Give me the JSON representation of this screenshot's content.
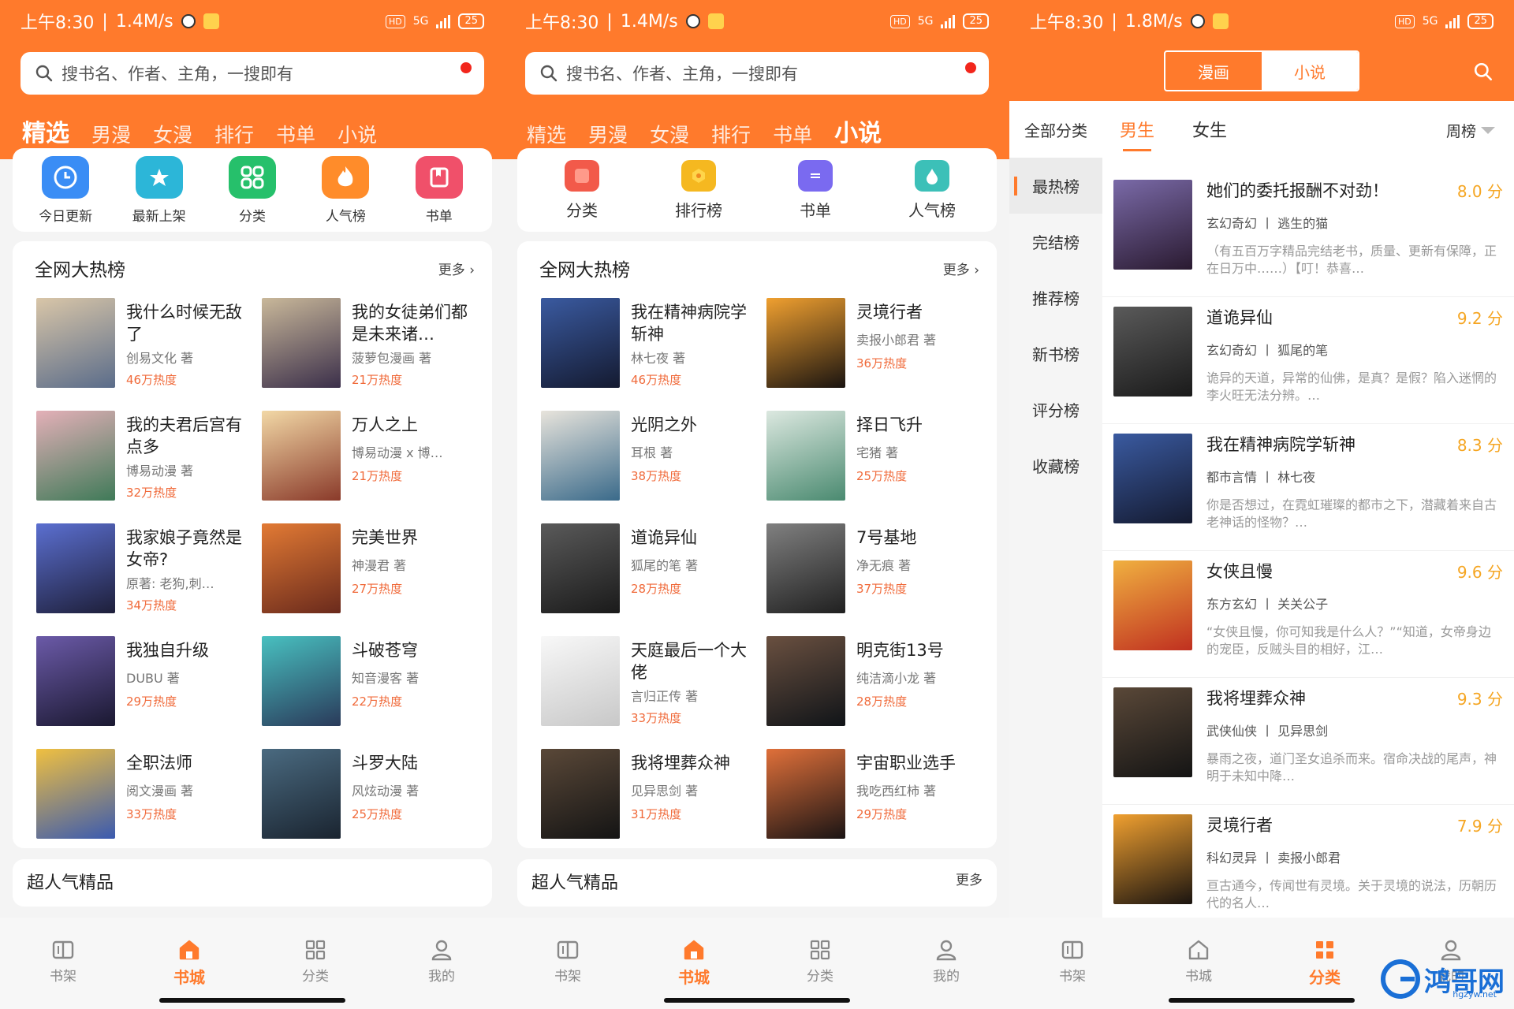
{
  "status": {
    "p1": {
      "time": "上午8:30",
      "speed": "1.4M/s",
      "battery": "25"
    },
    "p2": {
      "time": "上午8:30",
      "speed": "1.4M/s",
      "battery": "25"
    },
    "p3": {
      "time": "上午8:30",
      "speed": "1.8M/s",
      "battery": "25"
    },
    "hd": "HD",
    "net": "5G"
  },
  "colors": {
    "accent": "#ff7a2c",
    "heat": "#f06a3a",
    "score": "#f5a623"
  },
  "search": {
    "placeholder": "搜书名、作者、主角，一搜即有"
  },
  "tabs": [
    "精选",
    "男漫",
    "女漫",
    "排行",
    "书单",
    "小说"
  ],
  "p1": {
    "quick": [
      {
        "label": "今日更新",
        "icon": "clock-icon",
        "color": "#3a8df5"
      },
      {
        "label": "最新上架",
        "icon": "star-icon",
        "color": "#2cb6d8"
      },
      {
        "label": "分类",
        "icon": "grid-icon",
        "color": "#26c06b"
      },
      {
        "label": "人气榜",
        "icon": "flame-icon",
        "color": "#ff8c2a"
      },
      {
        "label": "书单",
        "icon": "bookmark-icon",
        "color": "#f0506a"
      }
    ],
    "hot_title": "全网大热榜",
    "more": "更多",
    "books": [
      {
        "title": "我什么时候无敌了",
        "author": "创易文化 著",
        "heat": "46万热度",
        "c1": "#d9c6a8",
        "c2": "#5a6c8a"
      },
      {
        "title": "我的女徒弟们都是未来诸…",
        "author": "菠萝包漫画 著",
        "heat": "21万热度",
        "c1": "#c9b89a",
        "c2": "#3b2f4a"
      },
      {
        "title": "我的夫君后宫有点多",
        "author": "博易动漫 著",
        "heat": "32万热度",
        "c1": "#e4b0b8",
        "c2": "#3f7a58"
      },
      {
        "title": "万人之上",
        "author": "博易动漫 x 博…",
        "heat": "21万热度",
        "c1": "#f2d8a6",
        "c2": "#8a3a2a"
      },
      {
        "title": "我家娘子竟然是女帝?",
        "author": "原著: 老狗,刺…",
        "heat": "34万热度",
        "c1": "#5b6fd0",
        "c2": "#1e1f3a"
      },
      {
        "title": "完美世界",
        "author": "神漫君 著",
        "heat": "27万热度",
        "c1": "#e27a34",
        "c2": "#6a2a1c"
      },
      {
        "title": "我独自升级",
        "author": "DUBU 著",
        "heat": "29万热度",
        "c1": "#6b5aa8",
        "c2": "#1a1830"
      },
      {
        "title": "斗破苍穹",
        "author": "知音漫客 著",
        "heat": "22万热度",
        "c1": "#48c0c0",
        "c2": "#2a3a5a"
      },
      {
        "title": "全职法师",
        "author": "阅文漫画 著",
        "heat": "33万热度",
        "c1": "#f0c040",
        "c2": "#3a5ab0"
      },
      {
        "title": "斗罗大陆",
        "author": "风炫动漫 著",
        "heat": "25万热度",
        "c1": "#4a6a80",
        "c2": "#1a2430"
      }
    ],
    "next_title": "超人气精品"
  },
  "p2": {
    "quick": [
      {
        "label": "分类",
        "icon": "category-icon",
        "color": "#f25a4a"
      },
      {
        "label": "排行榜",
        "icon": "medal-icon",
        "color": "#f5b820"
      },
      {
        "label": "书单",
        "icon": "list-icon",
        "color": "#7a6af0"
      },
      {
        "label": "人气榜",
        "icon": "drop-icon",
        "color": "#3cc0b8"
      }
    ],
    "hot_title": "全网大热榜",
    "more": "更多",
    "books": [
      {
        "title": "我在精神病院学斩神",
        "author": "林七夜 著",
        "heat": "46万热度",
        "c1": "#3a5aa0",
        "c2": "#141a30"
      },
      {
        "title": "灵境行者",
        "author": "卖报小郎君 著",
        "heat": "36万热度",
        "c1": "#f0a030",
        "c2": "#1a1410"
      },
      {
        "title": "光阴之外",
        "author": "耳根 著",
        "heat": "38万热度",
        "c1": "#e8e4dc",
        "c2": "#3a6a8a"
      },
      {
        "title": "择日飞升",
        "author": "宅猪 著",
        "heat": "25万热度",
        "c1": "#dce8e0",
        "c2": "#4a8a70"
      },
      {
        "title": "道诡异仙",
        "author": "狐尾的笔 著",
        "heat": "28万热度",
        "c1": "#5a5a5a",
        "c2": "#1a1a1a"
      },
      {
        "title": "7号基地",
        "author": "净无痕 著",
        "heat": "37万热度",
        "c1": "#808080",
        "c2": "#202020"
      },
      {
        "title": "天庭最后一个大佬",
        "author": "言归正传 著",
        "heat": "33万热度",
        "c1": "#f8f8f8",
        "c2": "#c8c8c8"
      },
      {
        "title": "明克街13号",
        "author": "纯洁滴小龙 著",
        "heat": "28万热度",
        "c1": "#6a5040",
        "c2": "#101418"
      },
      {
        "title": "我将埋葬众神",
        "author": "见异思剑 著",
        "heat": "31万热度",
        "c1": "#5a4838",
        "c2": "#141414"
      },
      {
        "title": "宇宙职业选手",
        "author": "我吃西红柿 著",
        "heat": "29万热度",
        "c1": "#e0703a",
        "c2": "#1a1414"
      }
    ],
    "next_title": "超人气精品",
    "next_more": "更多"
  },
  "p3": {
    "seg": [
      "漫画",
      "小说"
    ],
    "side": [
      "全部分类",
      "最热榜",
      "完结榜",
      "推荐榜",
      "新书榜",
      "评分榜",
      "收藏榜"
    ],
    "gender": [
      "男生",
      "女生"
    ],
    "sort": "周榜",
    "ranks": [
      {
        "title": "她们的委托报酬不对劲！",
        "score": "8.0 分",
        "tags": "玄幻奇幻 丨 逃生的猫",
        "desc": "（有五百万字精品完结老书，质量、更新有保障，正在日万中……）【叮！恭喜…",
        "c1": "#7a6aa8",
        "c2": "#2a1a30"
      },
      {
        "title": "道诡异仙",
        "score": "9.2 分",
        "tags": "玄幻奇幻 丨 狐尾的笔",
        "desc": "诡异的天道，异常的仙佛，是真？是假？陷入迷惘的李火旺无法分辨。…",
        "c1": "#5a5a5a",
        "c2": "#1a1a1a"
      },
      {
        "title": "我在精神病院学斩神",
        "score": "8.3 分",
        "tags": "都市言情 丨 林七夜",
        "desc": "你是否想过，在霓虹璀璨的都市之下，潜藏着来自古老神话的怪物？…",
        "c1": "#3a5aa0",
        "c2": "#141a30"
      },
      {
        "title": "女侠且慢",
        "score": "9.6 分",
        "tags": "东方玄幻 丨 关关公子",
        "desc": "“女侠且慢，你可知我是什么人？”“知道，女帝身边的宠臣，反贼头目的相好，江…",
        "c1": "#f0b040",
        "c2": "#c03020"
      },
      {
        "title": "我将埋葬众神",
        "score": "9.3 分",
        "tags": "武侠仙侠 丨 见异思剑",
        "desc": "暴雨之夜，道门圣女追杀而来。宿命决战的尾声，神明于未知中降…",
        "c1": "#5a4838",
        "c2": "#141414"
      },
      {
        "title": "灵境行者",
        "score": "7.9 分",
        "tags": "科幻灵异 丨 卖报小郎君",
        "desc": "亘古通今，传闻世有灵境。关于灵境的说法，历朝历代的名人…",
        "c1": "#f0a030",
        "c2": "#1a1410"
      }
    ]
  },
  "nav": [
    {
      "label": "书架",
      "icon": "bookshelf-icon"
    },
    {
      "label": "书城",
      "icon": "store-icon"
    },
    {
      "label": "分类",
      "icon": "category-icon"
    },
    {
      "label": "我的",
      "icon": "profile-icon"
    }
  ],
  "watermark": {
    "text": "鸿哥网",
    "sub": "hgzyw.net"
  }
}
